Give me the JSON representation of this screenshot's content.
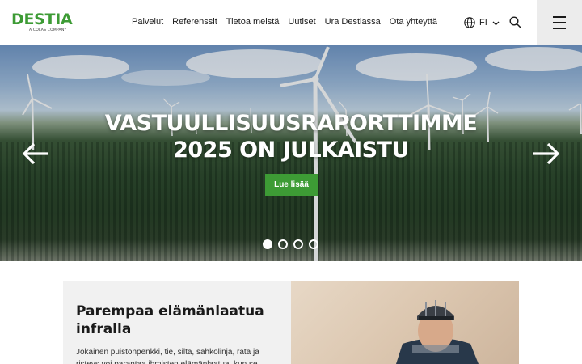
{
  "header": {
    "logo": {
      "word": "DESTIA",
      "tagline": "A COLAS COMPANY"
    },
    "nav": [
      {
        "label": "Palvelut"
      },
      {
        "label": "Referenssit"
      },
      {
        "label": "Tietoa meistä"
      },
      {
        "label": "Uutiset"
      },
      {
        "label": "Ura Destiassa"
      },
      {
        "label": "Ota yhteyttä"
      }
    ],
    "language": {
      "code": "FI",
      "icon": "globe-icon"
    },
    "search_icon": "search-icon",
    "menu_icon": "hamburger-menu-icon"
  },
  "hero": {
    "title_line1": "VASTUULLISUUSRAPORTTIMME",
    "title_line2": "2025 ON JULKAISTU",
    "cta_label": "Lue lisää",
    "slides_total": 4,
    "active_slide": 1,
    "prev_icon": "arrow-left-icon",
    "next_icon": "arrow-right-icon"
  },
  "content": {
    "card_title": "Parempaa elämänlaatua infralla",
    "card_text": "Jokainen puistonpenkki, tie, silta, sähkölinja, rata ja risteys voi parantaa ihmisten elämänlaatua, kun se"
  },
  "colors": {
    "brand_green": "#3d9b35",
    "menu_bg": "#ececec",
    "card_bg": "#f1f1f1"
  }
}
